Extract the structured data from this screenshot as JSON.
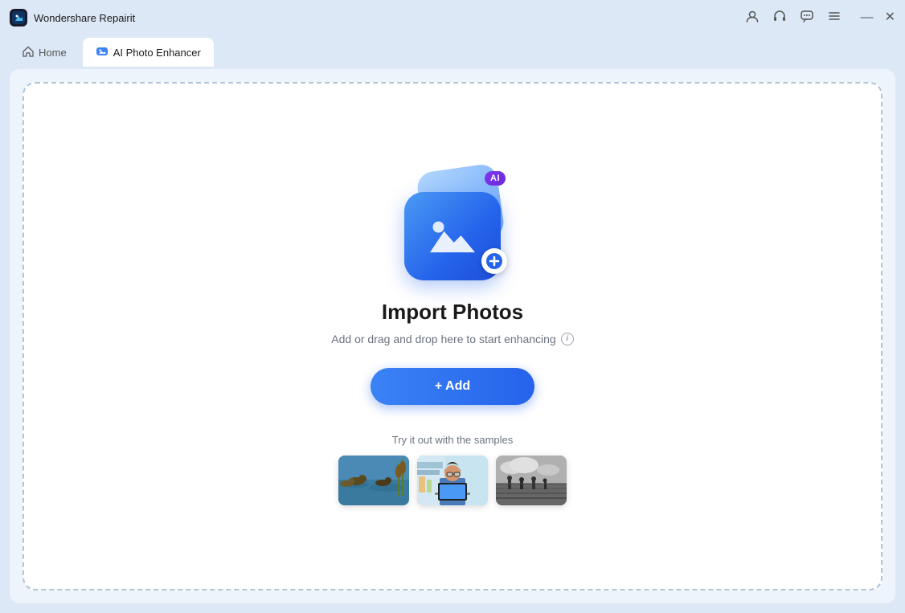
{
  "titleBar": {
    "appName": "Wondershare Repairit",
    "icons": {
      "user": "👤",
      "headphone": "🎧",
      "chat": "💬",
      "menu": "☰",
      "minimize": "—",
      "close": "✕"
    }
  },
  "tabs": {
    "home": {
      "label": "Home",
      "icon": "🏠"
    },
    "active": {
      "label": "AI Photo Enhancer",
      "icon": "🖼"
    }
  },
  "dropZone": {
    "title": "Import Photos",
    "subtitle": "Add or drag and drop here to start enhancing",
    "addButton": "+ Add",
    "samplesLabel": "Try it out with the samples"
  },
  "aiBadge": "AI",
  "samples": [
    {
      "id": "sample-ducks",
      "alt": "Ducks on water"
    },
    {
      "id": "sample-person",
      "alt": "Person at desk with laptop"
    },
    {
      "id": "sample-field",
      "alt": "Black and white field scene"
    }
  ]
}
